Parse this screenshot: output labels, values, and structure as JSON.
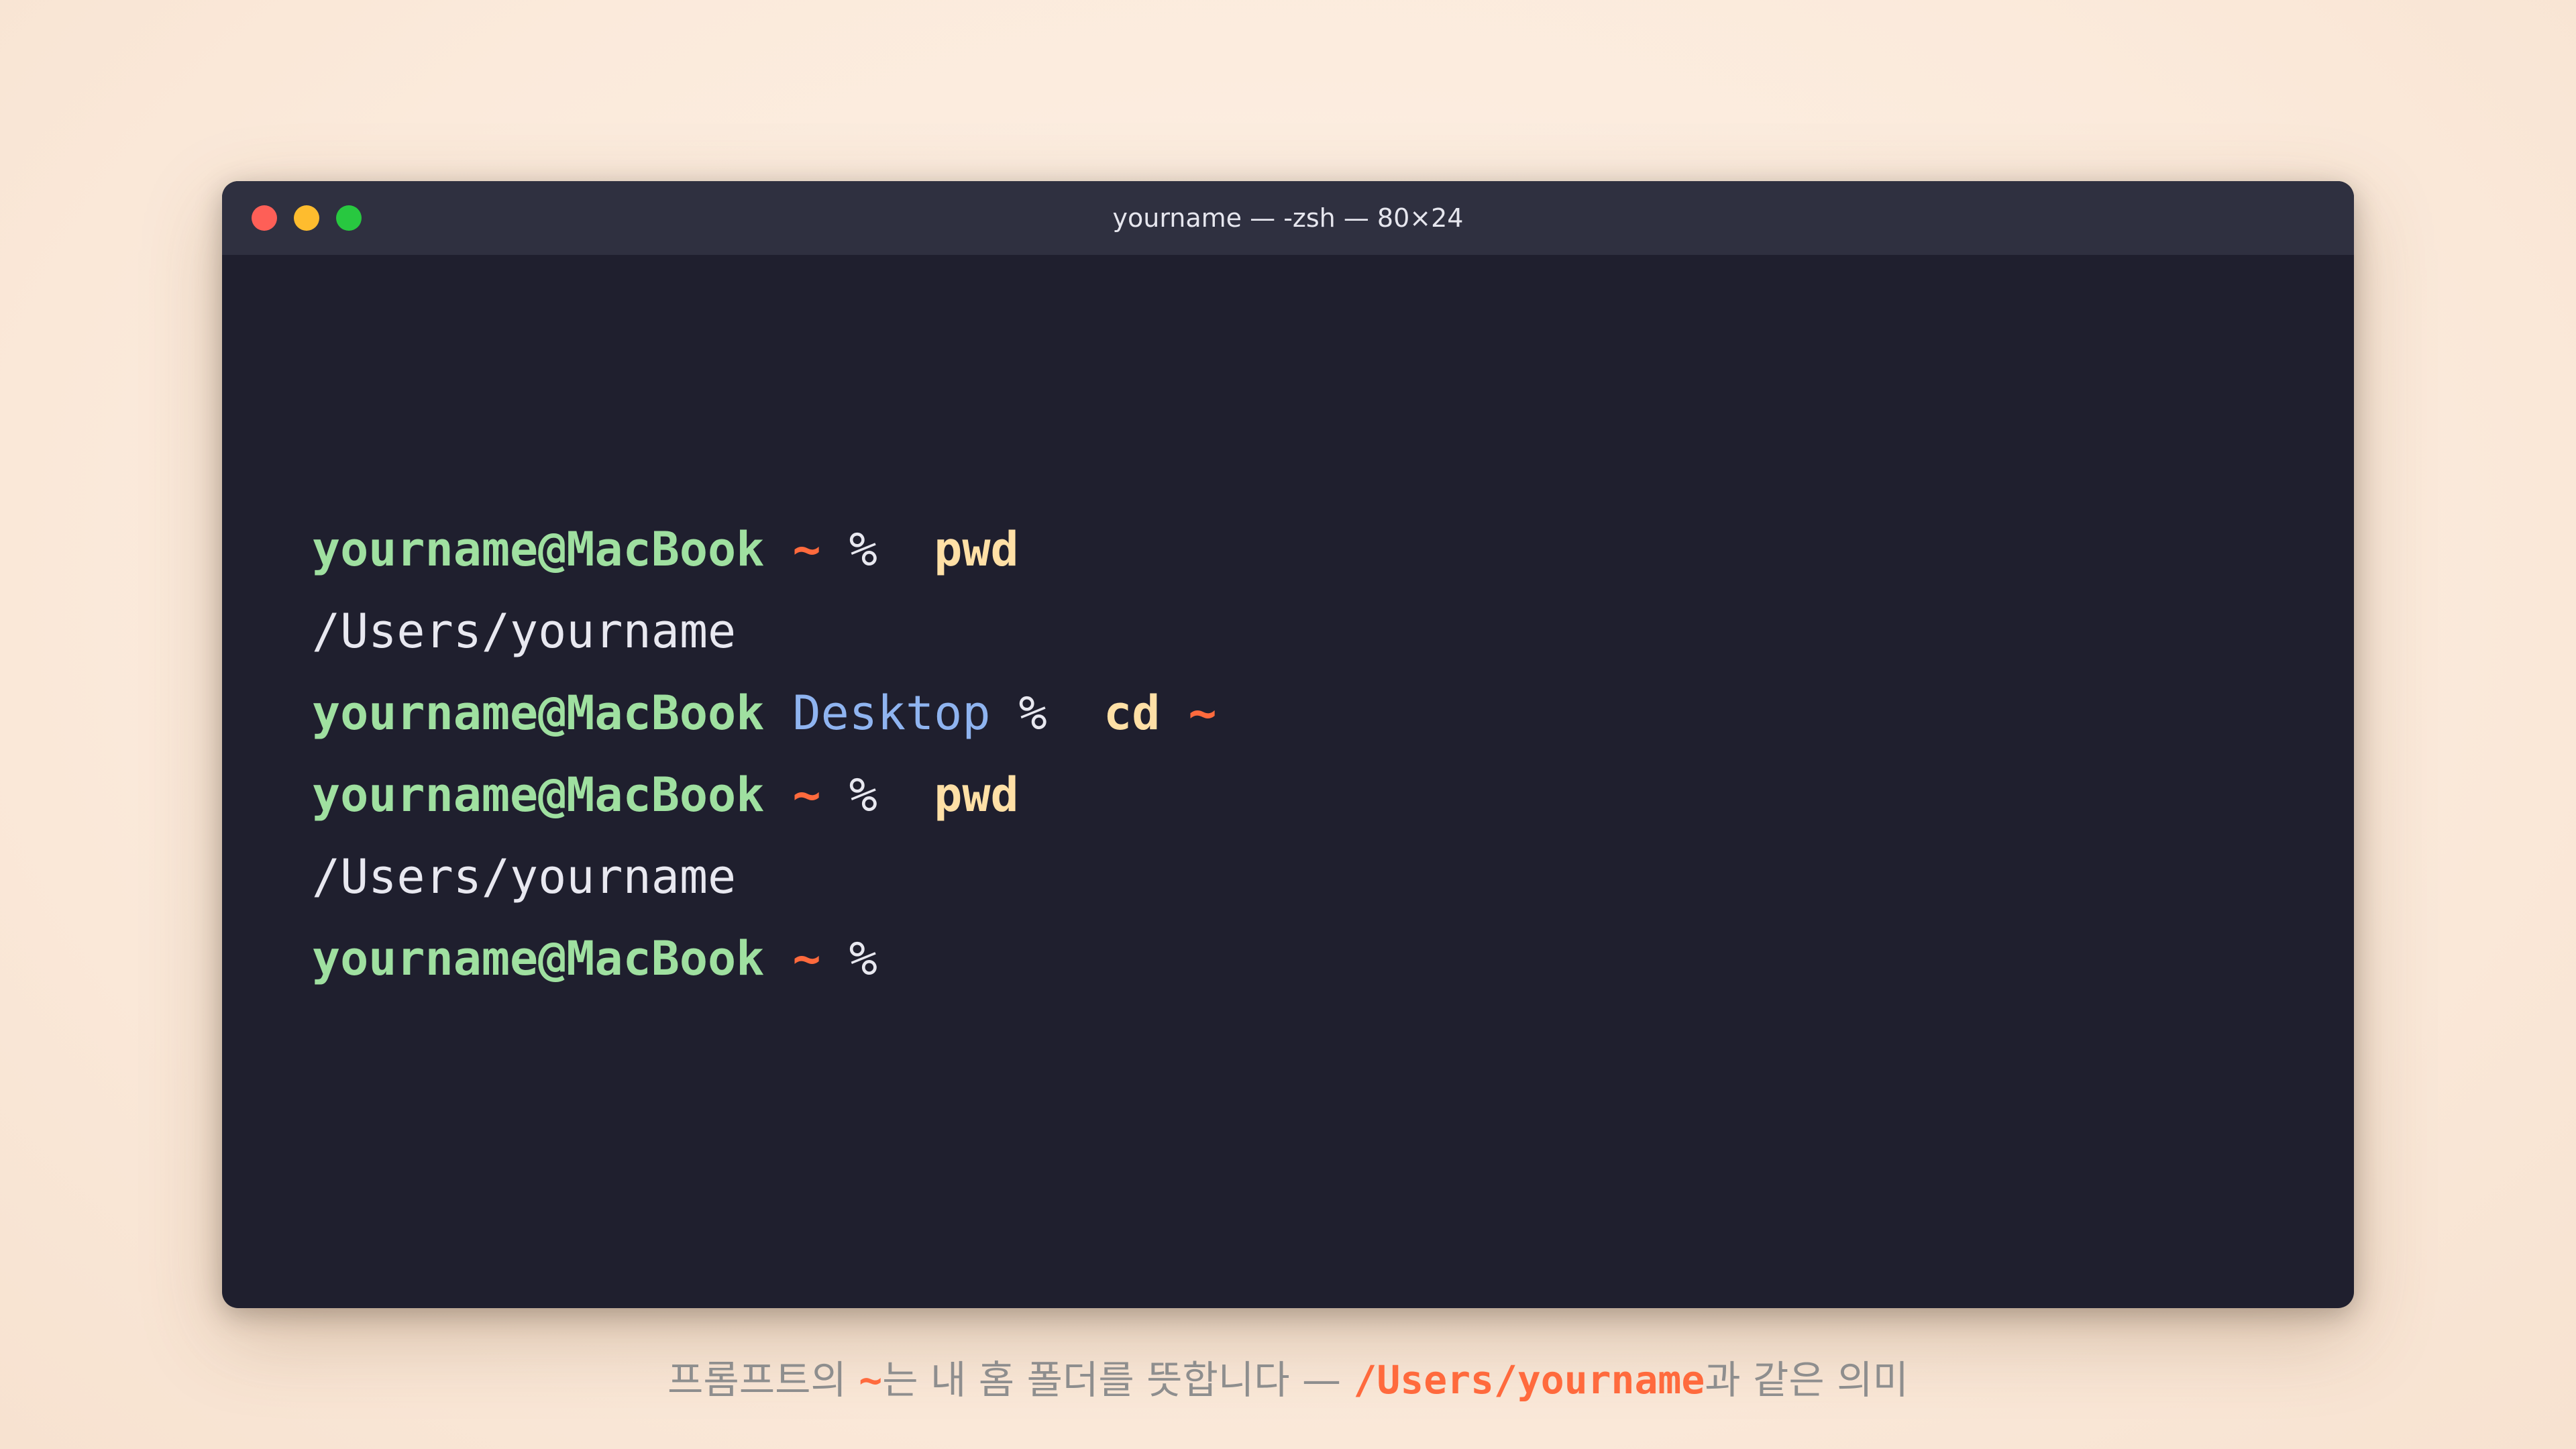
{
  "window": {
    "title": "yourname — -zsh — 80×24"
  },
  "terminal": {
    "lines": [
      {
        "user": "yourname@MacBook",
        "dir": "~",
        "prompt": "%",
        "cmd": "pwd"
      },
      {
        "output": "/Users/yourname"
      },
      {
        "user": "yourname@MacBook",
        "dir": "Desktop",
        "prompt": "%",
        "cmd": "cd",
        "arg": "~"
      },
      {
        "user": "yourname@MacBook",
        "dir": "~",
        "prompt": "%",
        "cmd": "pwd"
      },
      {
        "output": "/Users/yourname"
      },
      {
        "user": "yourname@MacBook",
        "dir": "~",
        "prompt": "%"
      }
    ]
  },
  "caption": {
    "part1": "프롬프트의 ",
    "tilde": "~",
    "part2": "는 내 홈 폴더를 뜻합니다 — ",
    "path": "/Users/yourname",
    "part3": "과 같은 의미"
  },
  "colors": {
    "user": "#9fe0a0",
    "tilde": "#ff6a3d",
    "dir": "#8fb4f0",
    "command": "#ffe0a6",
    "background": "#1f1f2e",
    "titlebar": "#2f3040"
  }
}
